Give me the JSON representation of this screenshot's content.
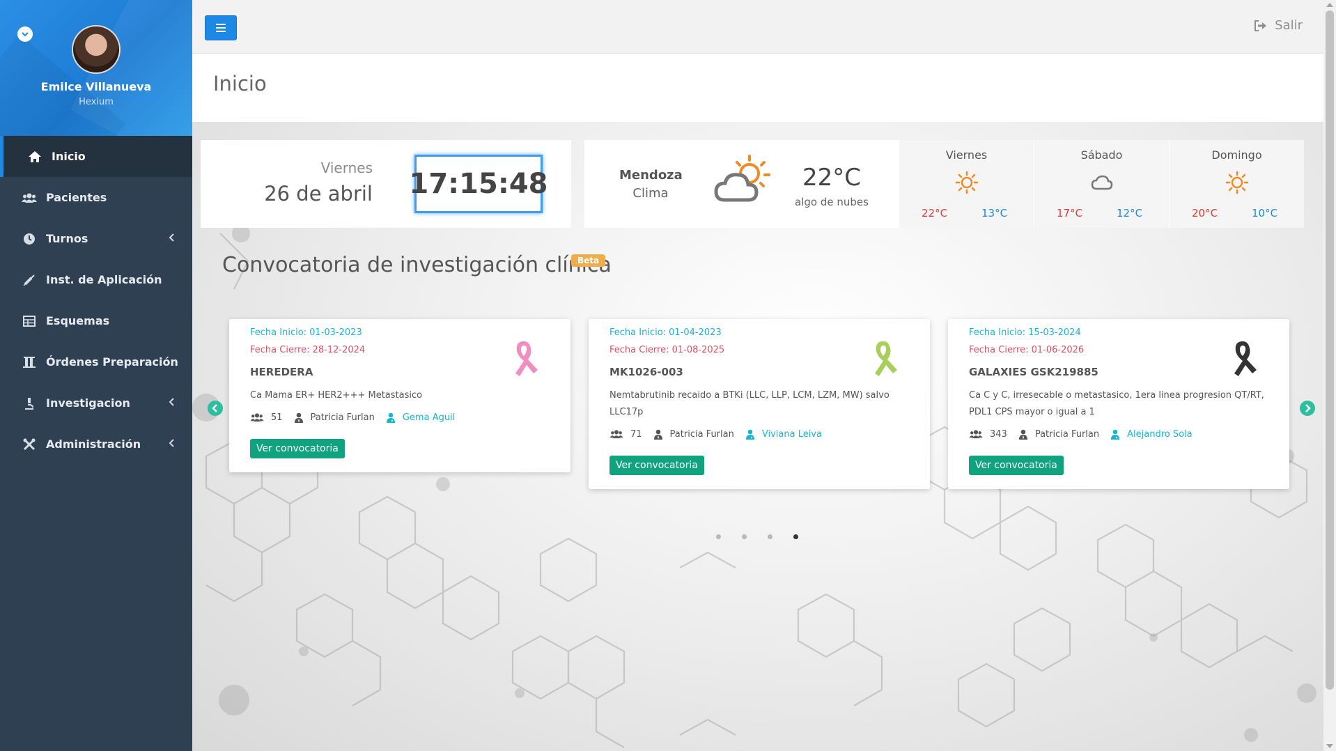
{
  "user": {
    "name": "Emilce Villanueva",
    "org": "Hexium"
  },
  "menu": [
    {
      "label": "Inicio",
      "icon": "home-icon",
      "active": true
    },
    {
      "label": "Pacientes",
      "icon": "users-icon"
    },
    {
      "label": "Turnos",
      "icon": "clock-icon",
      "has_children": true
    },
    {
      "label": "Inst. de Aplicación",
      "icon": "syringe-icon"
    },
    {
      "label": "Esquemas",
      "icon": "table-icon"
    },
    {
      "label": "Órdenes Preparación",
      "icon": "flask-icon"
    },
    {
      "label": "Investigacion",
      "icon": "microscope-icon",
      "has_children": true
    },
    {
      "label": "Administración",
      "icon": "tools-icon",
      "has_children": true
    }
  ],
  "topbar": {
    "logout_label": "Salir"
  },
  "page": {
    "title": "Inicio"
  },
  "date_widget": {
    "day": "Viernes",
    "date": "26 de abril",
    "time": "17:15:48"
  },
  "weather": {
    "city": "Mendoza",
    "label": "Clima",
    "temp": "22°C",
    "desc": "algo de nubes",
    "forecast": [
      {
        "day": "Viernes",
        "icon": "sun-icon",
        "max": "22°C",
        "min": "13°C"
      },
      {
        "day": "Sábado",
        "icon": "cloud-icon",
        "max": "17°C",
        "min": "12°C"
      },
      {
        "day": "Domingo",
        "icon": "sun-icon",
        "max": "20°C",
        "min": "10°C"
      }
    ]
  },
  "section": {
    "title": "Convocatoria de investigación clínica",
    "badge": "Beta"
  },
  "cards": [
    {
      "start": "Fecha Inicio: 01-03-2023",
      "end": "Fecha Cierre: 28-12-2024",
      "code": "HEREDERA",
      "desc": "Ca Mama ER+ HER2+++ Metastasico",
      "patients": "51",
      "investigator": "Patricia Furlan",
      "coordinator": "Gema Aguil",
      "button": "Ver convocatoria",
      "ribbon_color": "#ee8fc0"
    },
    {
      "start": "Fecha Inicio: 01-04-2023",
      "end": "Fecha Cierre: 01-08-2025",
      "code": "MK1026-003",
      "desc": "Nemtabrutinib recaido a BTKi (LLC, LLP, LCM, LZM, MW) salvo LLC17p",
      "patients": "71",
      "investigator": "Patricia Furlan",
      "coordinator": "Viviana Leiva",
      "button": "Ver convocatoria",
      "ribbon_color": "#a8cf5c"
    },
    {
      "start": "Fecha Inicio: 15-03-2024",
      "end": "Fecha Cierre: 01-06-2026",
      "code": "GALAXIES GSK219885",
      "desc": "Ca C y C, irresecable o metastasico, 1era linea progresion QT/RT, PDL1 CPS mayor o igual a 1",
      "patients": "343",
      "investigator": "Patricia Furlan",
      "coordinator": "Alejandro Sola",
      "button": "Ver convocatoria",
      "ribbon_color": "#333333"
    }
  ],
  "carousel": {
    "pages": 4,
    "active_page": 4
  },
  "colors": {
    "sidebar": "#2e4052",
    "accent": "#1e88e5",
    "teal": "#11a37f",
    "link": "#14b6d6",
    "red": "#e04e63"
  }
}
